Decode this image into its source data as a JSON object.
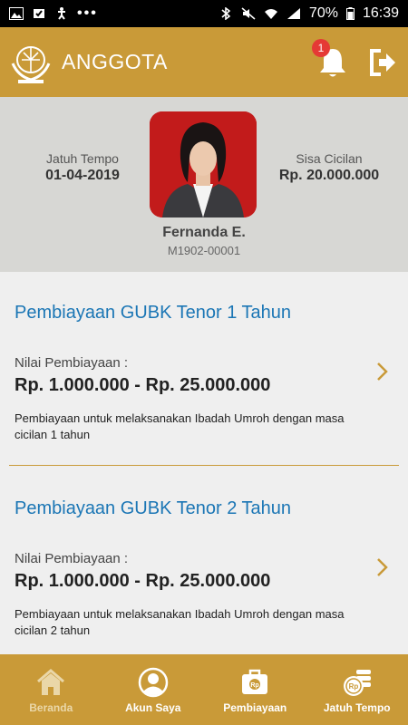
{
  "status_bar": {
    "battery": "70%",
    "time": "16:39",
    "dots": "•••"
  },
  "app_bar": {
    "title": "ANGGOTA",
    "notification_count": "1"
  },
  "profile": {
    "due_label": "Jatuh Tempo",
    "due_date": "01-04-2019",
    "remaining_label": "Sisa Cicilan",
    "remaining_amount": "Rp. 20.000.000",
    "name": "Fernanda E.",
    "member_id": "M1902-00001"
  },
  "financing": [
    {
      "title": "Pembiayaan GUBK Tenor 1 Tahun",
      "amount_label": "Nilai Pembiayaan :",
      "amount_range": "Rp. 1.000.000 - Rp. 25.000.000",
      "description": "Pembiayaan untuk melaksanakan Ibadah Umroh dengan masa cicilan 1 tahun"
    },
    {
      "title": "Pembiayaan GUBK Tenor 2 Tahun",
      "amount_label": "Nilai Pembiayaan :",
      "amount_range": "Rp. 1.000.000 - Rp. 25.000.000",
      "description": "Pembiayaan untuk melaksanakan Ibadah Umroh dengan masa cicilan 2 tahun"
    }
  ],
  "bottom_nav": [
    {
      "label": "Beranda",
      "icon": "home-icon",
      "active": false
    },
    {
      "label": "Akun Saya",
      "icon": "account-icon",
      "active": true
    },
    {
      "label": "Pembiayaan",
      "icon": "financing-bag-icon",
      "active": true
    },
    {
      "label": "Jatuh Tempo",
      "icon": "coins-icon",
      "active": true
    }
  ],
  "colors": {
    "brand": "#c99a38",
    "title_blue": "#1b76b5",
    "badge_red": "#e53935"
  }
}
